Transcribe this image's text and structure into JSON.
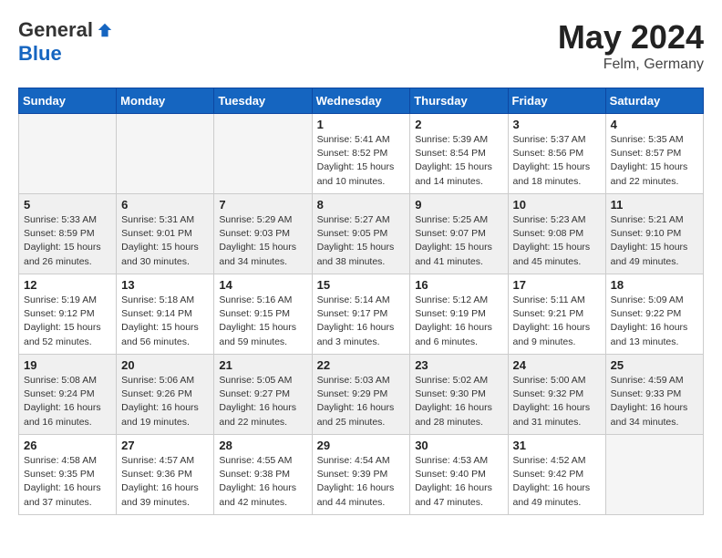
{
  "logo": {
    "general": "General",
    "blue": "Blue"
  },
  "header": {
    "month_year": "May 2024",
    "location": "Felm, Germany"
  },
  "weekdays": [
    "Sunday",
    "Monday",
    "Tuesday",
    "Wednesday",
    "Thursday",
    "Friday",
    "Saturday"
  ],
  "weeks": [
    [
      {
        "day": "",
        "info": "",
        "empty": true
      },
      {
        "day": "",
        "info": "",
        "empty": true
      },
      {
        "day": "",
        "info": "",
        "empty": true
      },
      {
        "day": "1",
        "info": "Sunrise: 5:41 AM\nSunset: 8:52 PM\nDaylight: 15 hours\nand 10 minutes."
      },
      {
        "day": "2",
        "info": "Sunrise: 5:39 AM\nSunset: 8:54 PM\nDaylight: 15 hours\nand 14 minutes."
      },
      {
        "day": "3",
        "info": "Sunrise: 5:37 AM\nSunset: 8:56 PM\nDaylight: 15 hours\nand 18 minutes."
      },
      {
        "day": "4",
        "info": "Sunrise: 5:35 AM\nSunset: 8:57 PM\nDaylight: 15 hours\nand 22 minutes."
      }
    ],
    [
      {
        "day": "5",
        "info": "Sunrise: 5:33 AM\nSunset: 8:59 PM\nDaylight: 15 hours\nand 26 minutes.",
        "shaded": true
      },
      {
        "day": "6",
        "info": "Sunrise: 5:31 AM\nSunset: 9:01 PM\nDaylight: 15 hours\nand 30 minutes.",
        "shaded": true
      },
      {
        "day": "7",
        "info": "Sunrise: 5:29 AM\nSunset: 9:03 PM\nDaylight: 15 hours\nand 34 minutes.",
        "shaded": true
      },
      {
        "day": "8",
        "info": "Sunrise: 5:27 AM\nSunset: 9:05 PM\nDaylight: 15 hours\nand 38 minutes.",
        "shaded": true
      },
      {
        "day": "9",
        "info": "Sunrise: 5:25 AM\nSunset: 9:07 PM\nDaylight: 15 hours\nand 41 minutes.",
        "shaded": true
      },
      {
        "day": "10",
        "info": "Sunrise: 5:23 AM\nSunset: 9:08 PM\nDaylight: 15 hours\nand 45 minutes.",
        "shaded": true
      },
      {
        "day": "11",
        "info": "Sunrise: 5:21 AM\nSunset: 9:10 PM\nDaylight: 15 hours\nand 49 minutes.",
        "shaded": true
      }
    ],
    [
      {
        "day": "12",
        "info": "Sunrise: 5:19 AM\nSunset: 9:12 PM\nDaylight: 15 hours\nand 52 minutes."
      },
      {
        "day": "13",
        "info": "Sunrise: 5:18 AM\nSunset: 9:14 PM\nDaylight: 15 hours\nand 56 minutes."
      },
      {
        "day": "14",
        "info": "Sunrise: 5:16 AM\nSunset: 9:15 PM\nDaylight: 15 hours\nand 59 minutes."
      },
      {
        "day": "15",
        "info": "Sunrise: 5:14 AM\nSunset: 9:17 PM\nDaylight: 16 hours\nand 3 minutes."
      },
      {
        "day": "16",
        "info": "Sunrise: 5:12 AM\nSunset: 9:19 PM\nDaylight: 16 hours\nand 6 minutes."
      },
      {
        "day": "17",
        "info": "Sunrise: 5:11 AM\nSunset: 9:21 PM\nDaylight: 16 hours\nand 9 minutes."
      },
      {
        "day": "18",
        "info": "Sunrise: 5:09 AM\nSunset: 9:22 PM\nDaylight: 16 hours\nand 13 minutes."
      }
    ],
    [
      {
        "day": "19",
        "info": "Sunrise: 5:08 AM\nSunset: 9:24 PM\nDaylight: 16 hours\nand 16 minutes.",
        "shaded": true
      },
      {
        "day": "20",
        "info": "Sunrise: 5:06 AM\nSunset: 9:26 PM\nDaylight: 16 hours\nand 19 minutes.",
        "shaded": true
      },
      {
        "day": "21",
        "info": "Sunrise: 5:05 AM\nSunset: 9:27 PM\nDaylight: 16 hours\nand 22 minutes.",
        "shaded": true
      },
      {
        "day": "22",
        "info": "Sunrise: 5:03 AM\nSunset: 9:29 PM\nDaylight: 16 hours\nand 25 minutes.",
        "shaded": true
      },
      {
        "day": "23",
        "info": "Sunrise: 5:02 AM\nSunset: 9:30 PM\nDaylight: 16 hours\nand 28 minutes.",
        "shaded": true
      },
      {
        "day": "24",
        "info": "Sunrise: 5:00 AM\nSunset: 9:32 PM\nDaylight: 16 hours\nand 31 minutes.",
        "shaded": true
      },
      {
        "day": "25",
        "info": "Sunrise: 4:59 AM\nSunset: 9:33 PM\nDaylight: 16 hours\nand 34 minutes.",
        "shaded": true
      }
    ],
    [
      {
        "day": "26",
        "info": "Sunrise: 4:58 AM\nSunset: 9:35 PM\nDaylight: 16 hours\nand 37 minutes."
      },
      {
        "day": "27",
        "info": "Sunrise: 4:57 AM\nSunset: 9:36 PM\nDaylight: 16 hours\nand 39 minutes."
      },
      {
        "day": "28",
        "info": "Sunrise: 4:55 AM\nSunset: 9:38 PM\nDaylight: 16 hours\nand 42 minutes."
      },
      {
        "day": "29",
        "info": "Sunrise: 4:54 AM\nSunset: 9:39 PM\nDaylight: 16 hours\nand 44 minutes."
      },
      {
        "day": "30",
        "info": "Sunrise: 4:53 AM\nSunset: 9:40 PM\nDaylight: 16 hours\nand 47 minutes."
      },
      {
        "day": "31",
        "info": "Sunrise: 4:52 AM\nSunset: 9:42 PM\nDaylight: 16 hours\nand 49 minutes."
      },
      {
        "day": "",
        "info": "",
        "empty": true
      }
    ]
  ]
}
